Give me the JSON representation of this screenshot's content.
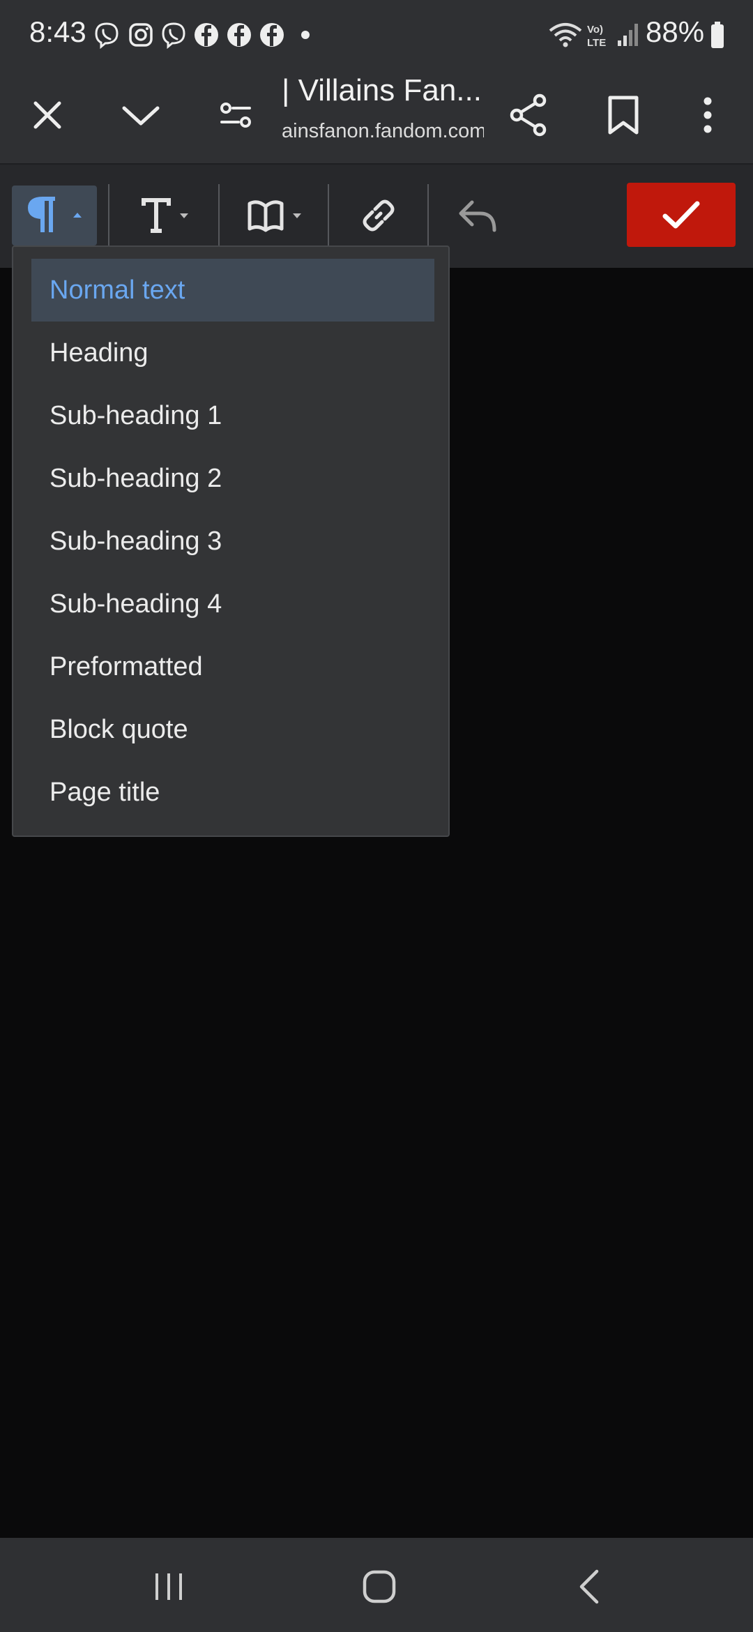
{
  "status_bar": {
    "time": "8:43",
    "battery": "88%",
    "notification_icons": [
      "viber-icon",
      "instagram-icon",
      "viber-icon",
      "facebook-icon",
      "facebook-icon",
      "facebook-icon",
      "dot-icon"
    ]
  },
  "browser": {
    "title": "| Villains Fan...",
    "url": "ainsfanon.fandom.com"
  },
  "editor_toolbar": {
    "items": [
      "paragraph-format",
      "text-style",
      "cite",
      "link",
      "undo",
      "save"
    ],
    "save_color": "#c0180c",
    "active_color": "#6aa7f0"
  },
  "format_menu": {
    "items": [
      {
        "label": "Normal text",
        "selected": true
      },
      {
        "label": "Heading",
        "selected": false
      },
      {
        "label": "Sub-heading 1",
        "selected": false
      },
      {
        "label": "Sub-heading 2",
        "selected": false
      },
      {
        "label": "Sub-heading 3",
        "selected": false
      },
      {
        "label": "Sub-heading 4",
        "selected": false
      },
      {
        "label": "Preformatted",
        "selected": false
      },
      {
        "label": "Block quote",
        "selected": false
      },
      {
        "label": "Page title",
        "selected": false
      }
    ]
  },
  "nav_bar": {
    "buttons": [
      "recents",
      "home",
      "back"
    ]
  }
}
